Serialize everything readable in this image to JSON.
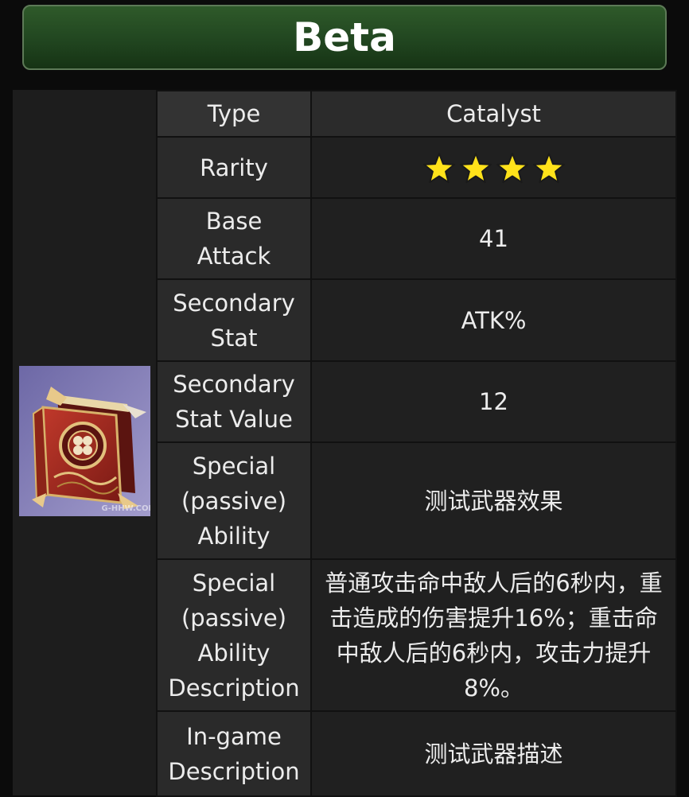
{
  "title": "Beta",
  "image": {
    "watermark": "G-HHW.COM"
  },
  "rows": {
    "type": {
      "label": "Type",
      "value": "Catalyst"
    },
    "rarity": {
      "label": "Rarity",
      "stars": 4,
      "star_color": "#ffe21a"
    },
    "base_attack": {
      "label_line1": "Base",
      "label_line2": "Attack",
      "value": "41"
    },
    "secondary_stat": {
      "label_line1": "Secondary",
      "label_line2": "Stat",
      "value": "ATK%"
    },
    "secondary_stat_value": {
      "label_line1": "Secondary",
      "label_line2": "Stat Value",
      "value": "12"
    },
    "special_ability": {
      "label_line1": "Special",
      "label_line2": "(passive)",
      "label_line3": "Ability",
      "value": "测试武器效果"
    },
    "special_ability_desc": {
      "label_line1": "Special",
      "label_line2": "(passive)",
      "label_line3": "Ability",
      "label_line4": "Description",
      "value": "普通攻击命中敌人后的6秒内，重击造成的伤害提升16%；重击命中敌人后的6秒内，攻击力提升8%。"
    },
    "ingame_desc": {
      "label_line1": "In-game",
      "label_line2": "Description",
      "value": "测试武器描述"
    }
  },
  "colors": {
    "title_green": "#214620",
    "catalyst_gold": "#d4a71a",
    "image_bg": "#7d78b3"
  }
}
